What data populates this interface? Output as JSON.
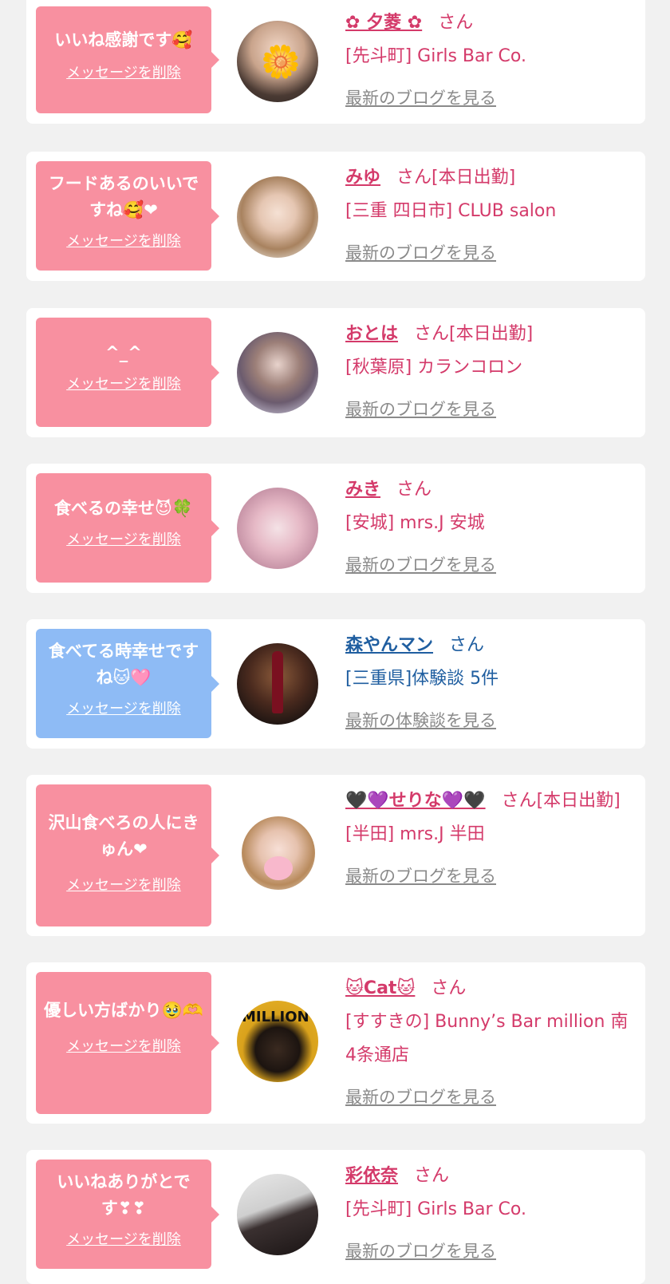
{
  "delete_label": "メッセージを削除",
  "cards": [
    {
      "message": "いいね感謝です🥰",
      "name": "✿ 夕菱 ✿",
      "suffix": "さん",
      "shop": "[先斗町] Girls Bar Co.",
      "link": "最新のブログを見る"
    },
    {
      "message": "フードあるのいいですね🥰❤",
      "name": "みゆ",
      "suffix": "さん[本日出勤]",
      "shop": "[三重 四日市] CLUB salon",
      "link": "最新のブログを見る"
    },
    {
      "message": "^_^",
      "name": "おとは",
      "suffix": "さん[本日出勤]",
      "shop": "[秋葉原] カランコロン",
      "link": "最新のブログを見る"
    },
    {
      "message": "食べるの幸せ😈🍀",
      "name": "みき",
      "suffix": "さん",
      "shop": "[安城] mrs.J 安城",
      "link": "最新のブログを見る"
    },
    {
      "message": "食べてる時幸せですね🐱🩷",
      "name": "森やんマン",
      "suffix": "さん",
      "shop": "[三重県]体験談 5件",
      "link": "最新の体験談を見る"
    },
    {
      "message": "沢山食べろの人にきゅん❤",
      "name": "🖤💜せりな💜🖤",
      "suffix": "さん[本日出勤]",
      "shop": "[半田] mrs.J 半田",
      "link": "最新のブログを見る"
    },
    {
      "message": "優しい方ばかり🥹🫶",
      "name": "🐱Cat🐱",
      "suffix": "さん",
      "shop": "[すすきの] Bunny’s Bar million 南4条通店",
      "link": "最新のブログを見る"
    },
    {
      "message": "いいねありがとです❣❣",
      "name": "彩依奈",
      "suffix": "さん",
      "shop": "[先斗町] Girls Bar Co.",
      "link": "最新のブログを見る"
    }
  ]
}
